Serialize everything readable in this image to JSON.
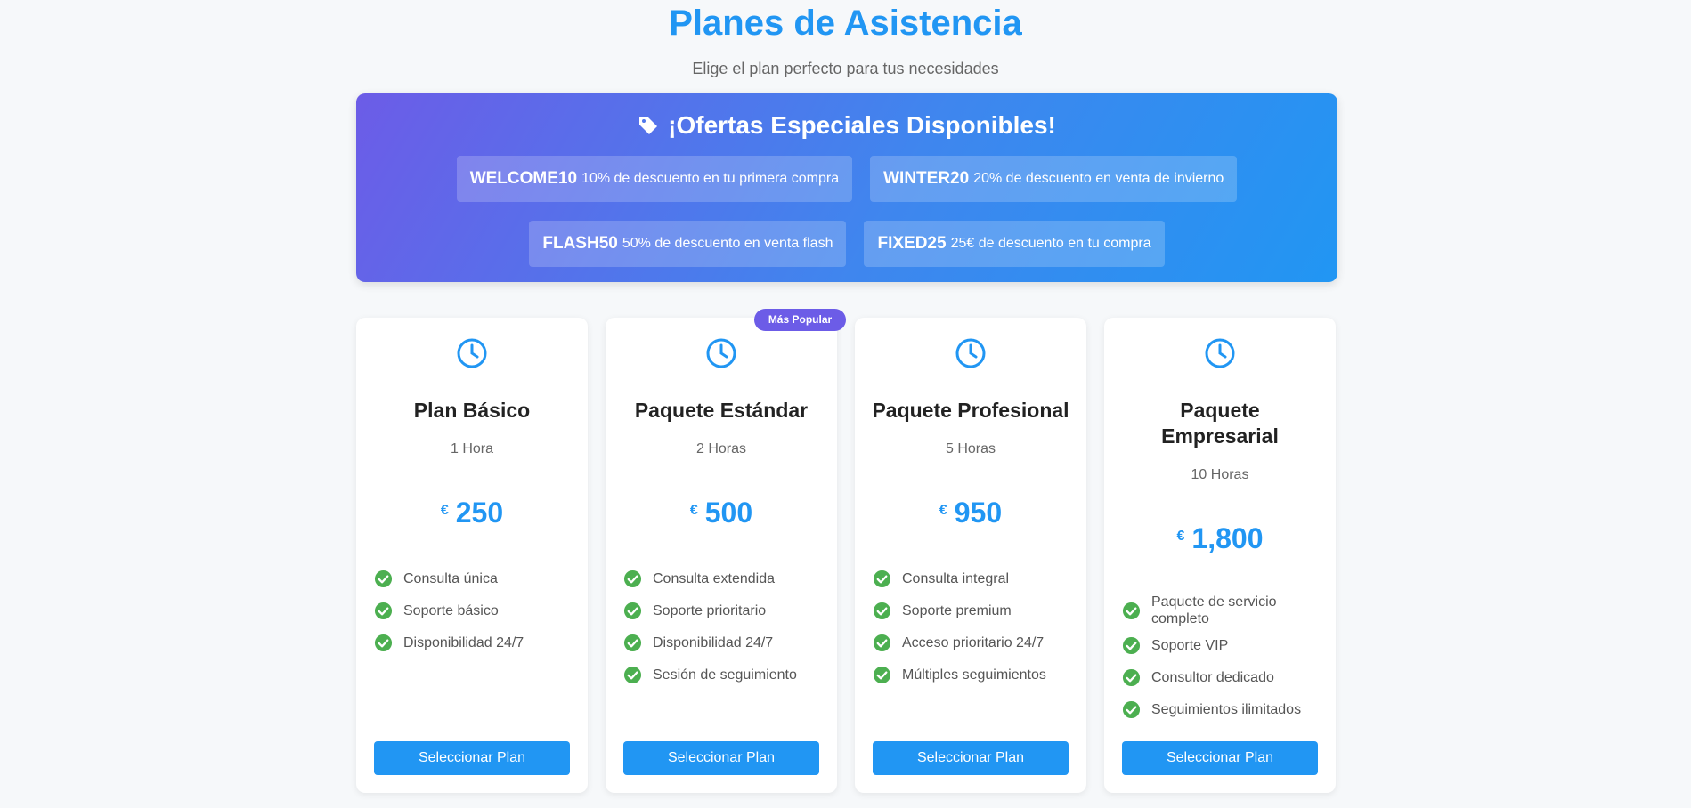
{
  "header": {
    "title": "Planes de Asistencia",
    "subtitle": "Elige el plan perfecto para tus necesidades"
  },
  "offers": {
    "title": "¡Ofertas Especiales Disponibles!",
    "icon": "tag-icon",
    "coupons": [
      {
        "code": "WELCOME10",
        "description": "10% de descuento en tu primera compra"
      },
      {
        "code": "WINTER20",
        "description": "20% de descuento en venta de invierno"
      },
      {
        "code": "FLASH50",
        "description": "50% de descuento en venta flash"
      },
      {
        "code": "FIXED25",
        "description": "25€ de descuento en tu compra"
      }
    ]
  },
  "plans": [
    {
      "name": "Plan Básico",
      "hours": "1 Hora",
      "currency": "€",
      "price": "250",
      "features": [
        "Consulta única",
        "Soporte básico",
        "Disponibilidad 24/7"
      ],
      "button": "Seleccionar Plan"
    },
    {
      "name": "Paquete Estándar",
      "hours": "2 Horas",
      "currency": "€",
      "price": "500",
      "badge": "Más Popular",
      "features": [
        "Consulta extendida",
        "Soporte prioritario",
        "Disponibilidad 24/7",
        "Sesión de seguimiento"
      ],
      "button": "Seleccionar Plan"
    },
    {
      "name": "Paquete Profesional",
      "hours": "5 Horas",
      "currency": "€",
      "price": "950",
      "features": [
        "Consulta integral",
        "Soporte premium",
        "Acceso prioritario 24/7",
        "Múltiples seguimientos"
      ],
      "button": "Seleccionar Plan"
    },
    {
      "name": "Paquete Empresarial",
      "hours": "10 Horas",
      "currency": "€",
      "price": "1,800",
      "features": [
        "Paquete de servicio completo",
        "Soporte VIP",
        "Consultor dedicado",
        "Seguimientos ilimitados"
      ],
      "button": "Seleccionar Plan"
    }
  ],
  "colors": {
    "accent": "#2196f3",
    "badge": "#6c5ce7",
    "check": "#4caf50"
  }
}
